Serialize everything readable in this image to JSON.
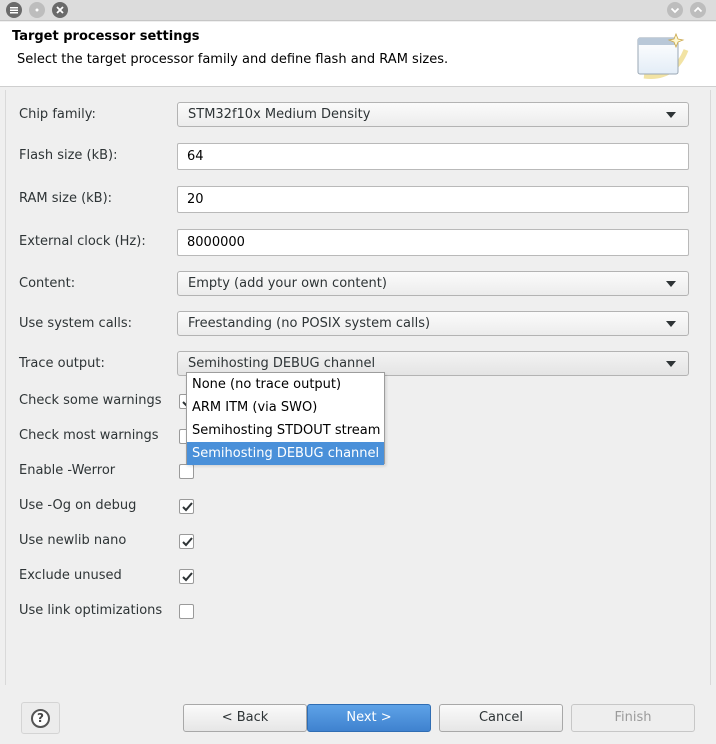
{
  "header": {
    "title": "Target processor settings",
    "description": "Select the target processor family and define flash and RAM sizes."
  },
  "form": {
    "chip_family": {
      "label": "Chip family:",
      "value": "STM32f10x Medium Density"
    },
    "flash_size": {
      "label": "Flash size (kB):",
      "value": "64"
    },
    "ram_size": {
      "label": "RAM size (kB):",
      "value": "20"
    },
    "external_clock": {
      "label": "External clock (Hz):",
      "value": "8000000"
    },
    "content": {
      "label": "Content:",
      "value": "Empty (add your own content)"
    },
    "system_calls": {
      "label": "Use system calls:",
      "value": "Freestanding (no POSIX system calls)"
    },
    "trace_output": {
      "label": "Trace output:",
      "value": "Semihosting DEBUG channel",
      "options": [
        "None (no trace output)",
        "ARM ITM (via SWO)",
        "Semihosting STDOUT stream",
        "Semihosting DEBUG channel"
      ],
      "selected_index": 3
    },
    "checkboxes": [
      {
        "label": "Check some warnings",
        "checked": true
      },
      {
        "label": "Check most warnings",
        "checked": false
      },
      {
        "label": "Enable -Werror",
        "checked": false
      },
      {
        "label": "Use -Og on debug",
        "checked": true
      },
      {
        "label": "Use newlib nano",
        "checked": true
      },
      {
        "label": "Exclude unused",
        "checked": true
      },
      {
        "label": "Use link optimizations",
        "checked": false
      }
    ]
  },
  "footer": {
    "help_symbol": "?",
    "back_label": "< Back",
    "next_label": "Next >",
    "cancel_label": "Cancel",
    "finish_label": "Finish"
  },
  "titlebar": {
    "menu_icon": "menu-icon",
    "min_icon": "chevron-down-icon",
    "max_icon": "chevron-up-icon",
    "close_icon": "close-icon"
  },
  "colors": {
    "accent": "#4a90d9",
    "primary_button": "#3f82cf"
  }
}
